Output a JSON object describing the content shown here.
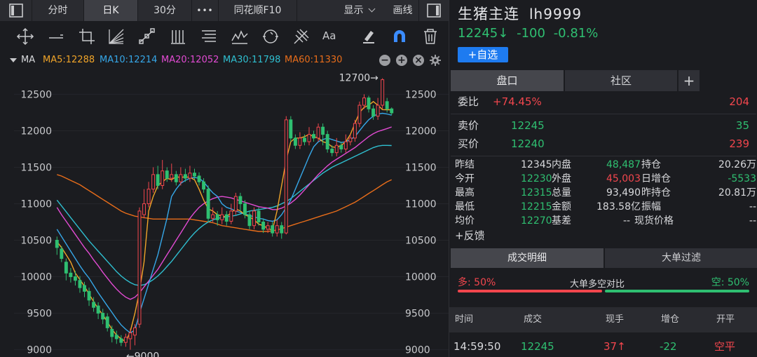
{
  "topbar": {
    "period_fenshi": "分时",
    "period_day": "日K",
    "period_30m": "30分",
    "more": "•••",
    "f10": "同花顺F10",
    "display": "显示",
    "draw": "画线"
  },
  "toolbar": {
    "text_tool": "Aa"
  },
  "ma_bar": {
    "label": "MA",
    "ma5": "MA5:12288",
    "ma10": "MA10:12214",
    "ma20": "MA20:12052",
    "ma30": "MA30:11798",
    "ma60": "MA60:11330"
  },
  "colors": {
    "up": "#f2464d",
    "down": "#2fbf71",
    "ma5": "#f0a429",
    "ma10": "#36a7e8",
    "ma20": "#e24bd3",
    "ma30": "#2fbfd0",
    "ma60": "#e86d1a",
    "accent": "#1e7bf0"
  },
  "chart_data": {
    "type": "candlestick",
    "ylim": [
      8900,
      12850
    ],
    "y_ticks": [
      "12500",
      "12000",
      "11500",
      "11000",
      "10500",
      "10000",
      "9500",
      "9000"
    ],
    "annotations": {
      "high": "12700→",
      "low": "←9000"
    },
    "candles": [
      [
        10500,
        10400,
        10550,
        10300
      ],
      [
        10380,
        10250,
        10420,
        10200
      ],
      [
        10200,
        10050,
        10250,
        9950
      ],
      [
        10050,
        10000,
        10120,
        9920
      ],
      [
        10000,
        9950,
        10080,
        9880
      ],
      [
        9950,
        9850,
        10010,
        9780
      ],
      [
        9880,
        9800,
        9930,
        9720
      ],
      [
        9800,
        9680,
        9850,
        9600
      ],
      [
        9650,
        9580,
        9720,
        9520
      ],
      [
        9600,
        9500,
        9650,
        9420
      ],
      [
        9500,
        9420,
        9560,
        9350
      ],
      [
        9450,
        9300,
        9500,
        9250
      ],
      [
        9280,
        9180,
        9330,
        9100
      ],
      [
        9200,
        9150,
        9260,
        9080
      ],
      [
        9150,
        9100,
        9200,
        9050
      ],
      [
        9100,
        9170,
        9220,
        9040
      ],
      [
        9150,
        9230,
        9290,
        9000
      ],
      [
        9200,
        9300,
        9350,
        9060
      ],
      [
        9350,
        10900,
        10950,
        9300
      ],
      [
        10850,
        11000,
        11200,
        10800
      ],
      [
        11000,
        11200,
        11300,
        10950
      ],
      [
        11200,
        11400,
        11500,
        11150
      ],
      [
        11400,
        11250,
        11520,
        11200
      ],
      [
        11250,
        11450,
        11600,
        11200
      ],
      [
        11450,
        11350,
        11500,
        11300
      ],
      [
        11350,
        11400,
        11550,
        11300
      ],
      [
        11400,
        11300,
        11450,
        11250
      ],
      [
        11300,
        11400,
        11500,
        11250
      ],
      [
        11400,
        11350,
        11480,
        11300
      ],
      [
        11350,
        11420,
        11520,
        11300
      ],
      [
        11420,
        11380,
        11480,
        11330
      ],
      [
        11380,
        11300,
        11430,
        11250
      ],
      [
        11300,
        11200,
        11350,
        11150
      ],
      [
        11200,
        10800,
        11250,
        10750
      ],
      [
        10800,
        10850,
        10950,
        10750
      ],
      [
        10850,
        10780,
        10900,
        10700
      ],
      [
        10780,
        10850,
        10950,
        10720
      ],
      [
        10850,
        10760,
        10900,
        10700
      ],
      [
        10760,
        10900,
        11000,
        10720
      ],
      [
        10900,
        11100,
        11150,
        10850
      ],
      [
        11100,
        11000,
        11150,
        10900
      ],
      [
        11000,
        10850,
        11050,
        10800
      ],
      [
        10850,
        10700,
        10900,
        10650
      ],
      [
        10700,
        10900,
        10950,
        10650
      ],
      [
        10900,
        10750,
        10950,
        10700
      ],
      [
        10750,
        10650,
        10800,
        10600
      ],
      [
        10650,
        10700,
        10750,
        10600
      ],
      [
        10700,
        10600,
        10750,
        10550
      ],
      [
        10600,
        10700,
        10780,
        10550
      ],
      [
        10700,
        10600,
        10750,
        10520
      ],
      [
        10600,
        12150,
        12200,
        10580
      ],
      [
        12150,
        11900,
        12200,
        11850
      ],
      [
        11900,
        11800,
        11950,
        11750
      ],
      [
        11800,
        11900,
        11980,
        11750
      ],
      [
        11900,
        11850,
        11950,
        11800
      ],
      [
        11850,
        11950,
        12050,
        11800
      ],
      [
        11950,
        11900,
        12000,
        11850
      ],
      [
        11900,
        12050,
        12100,
        11850
      ],
      [
        12050,
        11950,
        12100,
        11800
      ],
      [
        11950,
        11750,
        12000,
        11700
      ],
      [
        11750,
        11700,
        11800,
        11650
      ],
      [
        11700,
        11800,
        11900,
        11650
      ],
      [
        11800,
        11750,
        11850,
        11700
      ],
      [
        11750,
        11850,
        11950,
        11700
      ],
      [
        11850,
        11900,
        11950,
        11800
      ],
      [
        11900,
        12100,
        12150,
        11850
      ],
      [
        12100,
        12350,
        12400,
        12050
      ],
      [
        12350,
        12450,
        12500,
        12300
      ],
      [
        12450,
        12300,
        12480,
        12250
      ],
      [
        12300,
        12200,
        12350,
        12150
      ],
      [
        12200,
        12350,
        12450,
        12150
      ],
      [
        12350,
        12700,
        12720,
        12300
      ],
      [
        12400,
        12300,
        12450,
        12250
      ],
      [
        12300,
        12245,
        12320,
        12215
      ]
    ],
    "ma5": [
      10480,
      10400,
      10300,
      10200,
      10050,
      9960,
      9870,
      9760,
      9660,
      9560,
      9480,
      9380,
      9280,
      9200,
      9150,
      9110,
      9250,
      9500,
      9800,
      10200,
      10900,
      11100,
      11250,
      11300,
      11350,
      11330,
      11370,
      11360,
      11370,
      11360,
      11330,
      11200,
      11050,
      10930,
      10900,
      10850,
      10830,
      10820,
      10880,
      10930,
      10900,
      10850,
      10820,
      10780,
      10720,
      10700,
      10660,
      10640,
      10900,
      11250,
      11600,
      11850,
      11900,
      11900,
      11920,
      11950,
      11920,
      11900,
      11850,
      11830,
      11780,
      11770,
      11800,
      11850,
      11950,
      12100,
      12250,
      12320,
      12350,
      12400,
      12350,
      12290,
      12288,
      12288
    ],
    "ma10": [
      10650,
      10550,
      10450,
      10350,
      10250,
      10150,
      10060,
      9980,
      9880,
      9780,
      9690,
      9600,
      9510,
      9420,
      9340,
      9280,
      9230,
      9270,
      9500,
      9700,
      9900,
      10100,
      10300,
      10550,
      10800,
      11100,
      11200,
      11280,
      11320,
      11350,
      11360,
      11350,
      11300,
      11220,
      11150,
      11100,
      11000,
      10950,
      10930,
      10900,
      10880,
      10860,
      10840,
      10820,
      10800,
      10790,
      10770,
      10760,
      10780,
      10850,
      10950,
      11050,
      11200,
      11350,
      11500,
      11650,
      11780,
      11850,
      11880,
      11900,
      11880,
      11860,
      11840,
      11850,
      11880,
      11920,
      12000,
      12080,
      12150,
      12200,
      12230,
      12240,
      12230,
      12214
    ],
    "ma20": [
      10950,
      10850,
      10760,
      10670,
      10580,
      10490,
      10400,
      10320,
      10230,
      10150,
      10060,
      9980,
      9900,
      9830,
      9770,
      9720,
      9690,
      9720,
      9780,
      9860,
      9940,
      10020,
      10100,
      10200,
      10300,
      10400,
      10500,
      10600,
      10700,
      10800,
      10880,
      10950,
      11000,
      11040,
      11070,
      11090,
      11100,
      11090,
      11080,
      11060,
      11040,
      11020,
      11000,
      10980,
      10960,
      10950,
      10940,
      10920,
      10920,
      10940,
      10970,
      11010,
      11060,
      11120,
      11190,
      11260,
      11330,
      11400,
      11460,
      11520,
      11570,
      11610,
      11650,
      11690,
      11730,
      11770,
      11820,
      11870,
      11920,
      11960,
      11990,
      12010,
      12030,
      12052
    ],
    "ma30": [
      11050,
      10970,
      10890,
      10810,
      10730,
      10650,
      10570,
      10490,
      10420,
      10350,
      10280,
      10210,
      10140,
      10070,
      10010,
      9960,
      9920,
      9890,
      9880,
      9890,
      9920,
      9960,
      10010,
      10070,
      10140,
      10210,
      10290,
      10370,
      10450,
      10530,
      10600,
      10660,
      10710,
      10750,
      10780,
      10800,
      10810,
      10820,
      10830,
      10840,
      10860,
      10880,
      10900,
      10910,
      10920,
      10930,
      10940,
      10950,
      10970,
      11000,
      11030,
      11070,
      11120,
      11170,
      11220,
      11270,
      11320,
      11370,
      11420,
      11460,
      11500,
      11530,
      11560,
      11590,
      11620,
      11650,
      11680,
      11710,
      11740,
      11770,
      11790,
      11800,
      11800,
      11798
    ],
    "ma60": [
      11400,
      11380,
      11350,
      11320,
      11290,
      11260,
      11220,
      11180,
      11140,
      11100,
      11060,
      11020,
      10980,
      10940,
      10900,
      10870,
      10850,
      10830,
      10820,
      10810,
      10800,
      10790,
      10790,
      10790,
      10790,
      10790,
      10790,
      10790,
      10790,
      10790,
      10780,
      10770,
      10760,
      10750,
      10740,
      10720,
      10700,
      10690,
      10680,
      10670,
      10660,
      10650,
      10640,
      10630,
      10620,
      10620,
      10620,
      10630,
      10640,
      10660,
      10680,
      10700,
      10720,
      10740,
      10760,
      10780,
      10800,
      10820,
      10840,
      10860,
      10880,
      10900,
      10930,
      10960,
      10990,
      11020,
      11060,
      11100,
      11140,
      11180,
      11220,
      11260,
      11300,
      11330
    ]
  },
  "quote": {
    "name": "生猪主连",
    "code": "lh9999",
    "price": "12245",
    "arrow": "↓",
    "change": "-100",
    "change_pct": "-0.81%",
    "add_btn": "+自选"
  },
  "tabs1": {
    "pankou": "盘口",
    "shequ": "社区",
    "plus": "+"
  },
  "weibi": {
    "label": "委比",
    "value": "+74.45%",
    "num": "204"
  },
  "sell": {
    "label": "卖价",
    "price": "12245",
    "vol": "35"
  },
  "buy": {
    "label": "买价",
    "price": "12240",
    "vol": "239"
  },
  "stats": {
    "zuojie_l": "昨结",
    "zuojie_v": "12345",
    "neipan_l": "内盘",
    "neipan_v": "48,487",
    "chicang_l": "持仓",
    "chicang_v": "20.26万",
    "jinkai_l": "今开",
    "jinkai_v": "12230",
    "waipan_l": "外盘",
    "waipan_v": "45,003",
    "rizengcang_l": "日增仓",
    "rizengcang_v": "-5533",
    "zuigao_l": "最高",
    "zuigao_v": "12315",
    "zongliang_l": "总量",
    "zongliang_v": "93,490",
    "zuochicang_l": "昨持仓",
    "zuochicang_v": "20.81万",
    "zuidi_l": "最低",
    "zuidi_v": "12215",
    "jine_l": "金额",
    "jine_v": "183.58亿",
    "zhenfu_l": "振幅",
    "zhenfu_v": "--",
    "junjia_l": "均价",
    "junjia_v": "12270",
    "jicha_l": "基差",
    "jicha_v": "--",
    "xianhuo_l": "现货价格",
    "xianhuo_v": "--",
    "feedback": "+反馈"
  },
  "tabs2": {
    "detail": "成交明细",
    "bigorder": "大单过滤"
  },
  "longshort": {
    "long": "多: 50%",
    "title": "大单多空对比",
    "short": "空: 50%",
    "long_pct": 50
  },
  "trade_head": {
    "time": "时间",
    "deal": "成交",
    "hand": "现手",
    "zc": "增仓",
    "kp": "开平"
  },
  "trade_row": {
    "time": "14:59:50",
    "price": "12245",
    "hand": "37↑",
    "zc": "-22",
    "kp": "空平"
  }
}
